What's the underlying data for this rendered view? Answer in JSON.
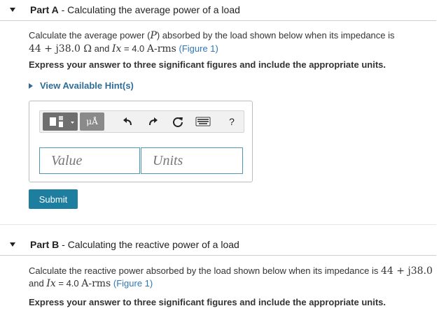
{
  "partA": {
    "label": "Part A",
    "sep": " - ",
    "title": "Calculating the average power of a load",
    "line1_prefix": "Calculate the average power (",
    "var_P": "P",
    "line1_suffix": ") absorbed by the load shown below when its impedance is",
    "impedance": "44 + j38.0 Ω",
    "and_text": " and ",
    "current_var": "Ix",
    "current_eq": " = 4.0 ",
    "current_unit": "A-rms",
    "figure_link": "(Figure 1)",
    "instruction": "Express your answer to three significant figures and include the appropriate units.",
    "hint_link": "View Available Hint(s)",
    "value_placeholder": "Value",
    "units_placeholder": "Units",
    "submit_label": "Submit",
    "toolbar": {
      "mu_label": "μÅ",
      "help_label": "?"
    }
  },
  "partB": {
    "label": "Part B",
    "sep": " - ",
    "title": "Calculating the reactive power of a load",
    "line1": "Calculate the reactive power absorbed by the load shown below when its impedance is ",
    "impedance": "44 + j38.0",
    "and_text": "and ",
    "current_var": "Ix",
    "current_eq": " = 4.0 ",
    "current_unit": "A-rms",
    "figure_link": "(Figure 1)",
    "instruction": "Express your answer to three significant figures and include the appropriate units."
  }
}
